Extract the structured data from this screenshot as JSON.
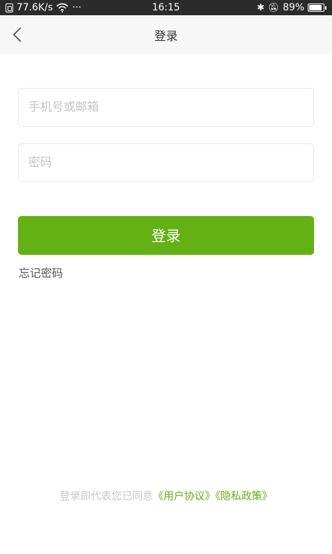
{
  "status_bar": {
    "speed": "77.6K/s",
    "dots": "···",
    "time": "16:15",
    "battery": "89%",
    "battery_level": 0.89,
    "icons": [
      "sim-icon",
      "wifi-icon",
      "bluetooth-icon",
      "mute-icon",
      "battery-icon"
    ]
  },
  "nav": {
    "title": "登录",
    "back_icon": "chevron-left-icon"
  },
  "form": {
    "account_placeholder": "手机号或邮箱",
    "password_placeholder": "密码",
    "login_label": "登录",
    "forgot_label": "忘记密码"
  },
  "agreement": {
    "prefix": "登录即代表您已同意",
    "user_agreement": "《用户协议》",
    "privacy_policy": "《隐私政策》"
  },
  "colors": {
    "accent": "#63b115",
    "nav_background": "#f7f7f7",
    "status_background": "#2b2b2b"
  }
}
